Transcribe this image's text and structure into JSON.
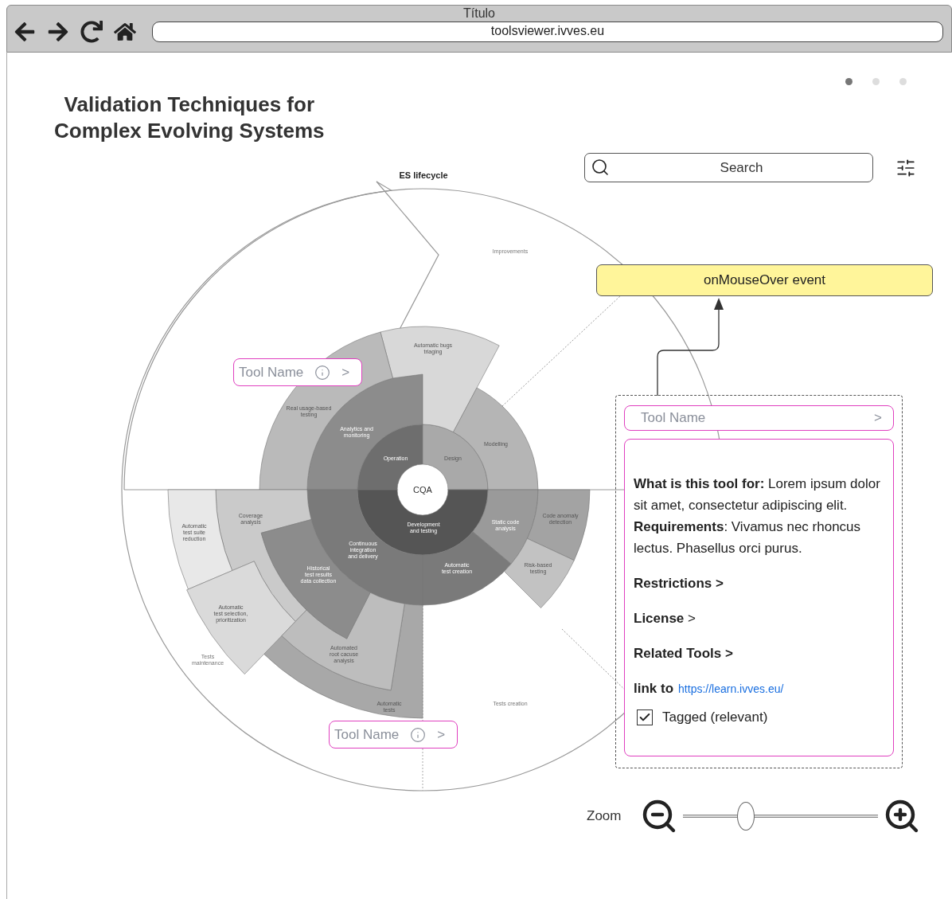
{
  "browser": {
    "title": "Título",
    "url": "toolsviewer.ivves.eu"
  },
  "carousel_dots": [
    {
      "selected": true
    },
    {
      "selected": false
    },
    {
      "selected": false
    }
  ],
  "title_lines": [
    "Validation Techniques for",
    "Complex Evolving Systems"
  ],
  "search": {
    "placeholder": "Search"
  },
  "diagram": {
    "title": "ES lifecycle",
    "center": "CQA",
    "segments": [
      {
        "lines": [
          "Operation"
        ]
      },
      {
        "lines": [
          "Design"
        ]
      },
      {
        "lines": [
          "Development",
          "and testing"
        ]
      },
      {
        "lines": [
          "Analytics and",
          "monitoring"
        ]
      },
      {
        "lines": [
          "Automatic bugs",
          "triaging"
        ]
      },
      {
        "lines": [
          "Modelling"
        ]
      },
      {
        "lines": [
          "Real usage-based",
          "testing"
        ]
      },
      {
        "lines": [
          "Static code",
          "analysis"
        ]
      },
      {
        "lines": [
          "Automatic",
          "test creation"
        ]
      },
      {
        "lines": [
          "Continuous",
          "integration",
          "and delivery"
        ]
      },
      {
        "lines": [
          "Code anomaly",
          "detection"
        ]
      },
      {
        "lines": [
          "Risk-based",
          "testing"
        ]
      },
      {
        "lines": [
          "Automatic",
          "tests"
        ]
      },
      {
        "lines": [
          "Coverage",
          "analysis"
        ]
      },
      {
        "lines": [
          "Automatic",
          "test suite",
          "reduction"
        ]
      },
      {
        "lines": [
          "Automatic",
          "test selection,",
          "prioritization"
        ]
      },
      {
        "lines": [
          "Automated",
          "root cacuse",
          "analysis"
        ]
      },
      {
        "lines": [
          "Historical",
          "test results",
          "data collection"
        ]
      }
    ],
    "outer_labels": [
      {
        "lines": [
          "Improvements"
        ]
      },
      {
        "lines": [
          "Tests",
          "maintenance"
        ]
      },
      {
        "lines": [
          "Tests creation"
        ]
      }
    ]
  },
  "tool_chips": [
    {
      "label": "Tool Name",
      "chevron": ">"
    },
    {
      "label": "Tool Name",
      "chevron": ">"
    }
  ],
  "event_note": "onMouseOver event",
  "tool_detail": {
    "title": "Tool Name",
    "chevron": ">",
    "paragraphs": [
      "**What is this tool for:** Lorem ipsum dolor sit amet, consectetur adipiscing elit.",
      "**Requirements**: Vivamus nec rhoncus lectus. Phasellus orci purus."
    ],
    "sections": [
      "**Restrictions >**",
      "**License** >",
      "**Related Tools >**"
    ],
    "link_label": "link to",
    "link_url": "https://learn.ivves.eu/",
    "tag": {
      "label": "Tagged (relevant)",
      "checked": true
    }
  },
  "zoom": {
    "label": "Zoom",
    "level": 0.32
  }
}
